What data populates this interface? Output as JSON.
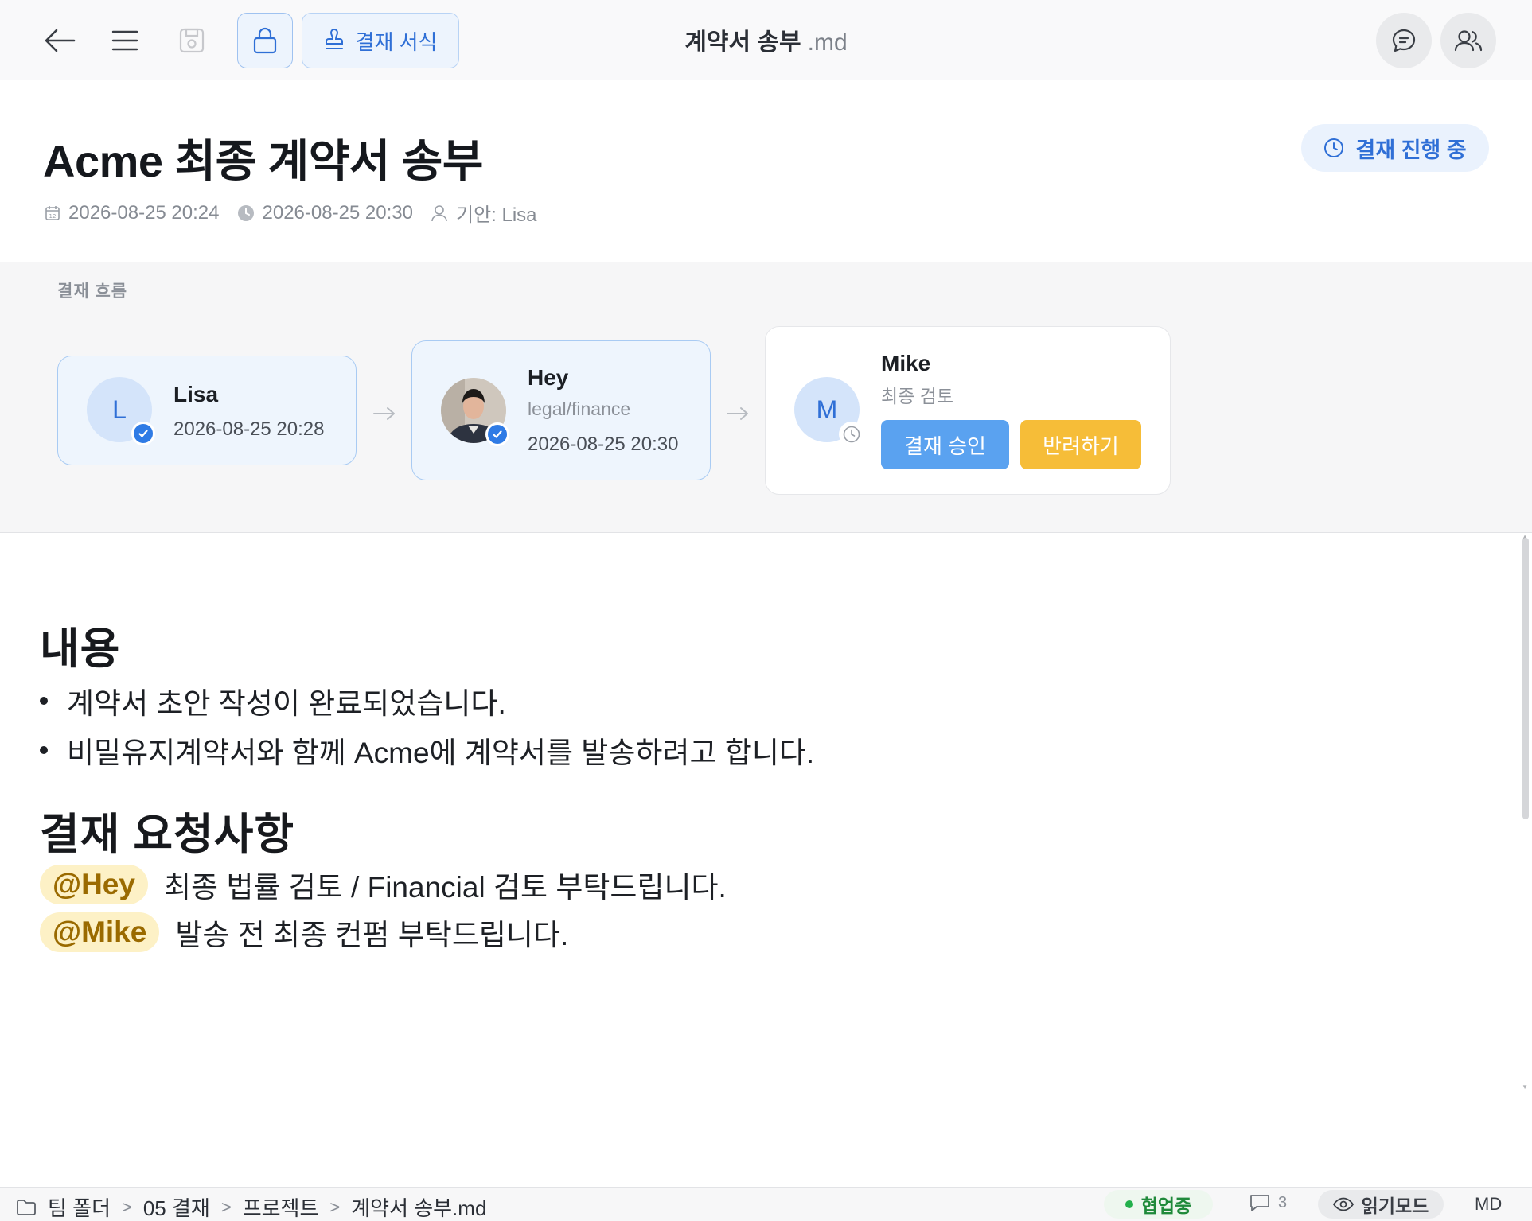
{
  "toolbar": {
    "form_button_label": "결재 서식",
    "doc_name": "계약서 송부",
    "doc_ext": ".md"
  },
  "header": {
    "title": "Acme 최종 계약서 송부",
    "created": "2026-08-25 20:24",
    "modified": "2026-08-25 20:30",
    "drafter": "기안: Lisa",
    "status": "결재 진행 중"
  },
  "flow": {
    "label": "결재 흐름",
    "steps": [
      {
        "initial": "L",
        "name": "Lisa",
        "role": "",
        "date": "2026-08-25 20:28",
        "state": "approved"
      },
      {
        "initial": "",
        "name": "Hey",
        "role": "legal/finance",
        "date": "2026-08-25 20:30",
        "state": "approved"
      },
      {
        "initial": "M",
        "name": "Mike",
        "role": "최종 검토",
        "date": "",
        "state": "pending"
      }
    ],
    "approve_label": "결재 승인",
    "reject_label": "반려하기"
  },
  "content": {
    "section1_title": "내용",
    "bullets": [
      "계약서 초안 작성이 완료되었습니다.",
      "비밀유지계약서와 함께 Acme에 계약서를 발송하려고 합니다."
    ],
    "section2_title": "결재 요청사항",
    "requests": [
      {
        "mention": "@Hey",
        "text": "최종 법률 검토 / Financial 검토 부탁드립니다."
      },
      {
        "mention": "@Mike",
        "text": "발송 전 최종 컨펌 부탁드립니다."
      }
    ]
  },
  "statusbar": {
    "breadcrumbs": [
      "팀 폴더",
      "05 결재",
      "프로젝트",
      "계약서 송부.md"
    ],
    "collab_label": "협업중",
    "comment_count": "3",
    "read_mode_label": "읽기모드",
    "format": "MD"
  },
  "colors": {
    "accent": "#2f6fd6",
    "approve": "#5aa2f0",
    "reject": "#f6bd38",
    "mention_bg": "#fdf1c6",
    "collab_green": "#22b04b"
  }
}
